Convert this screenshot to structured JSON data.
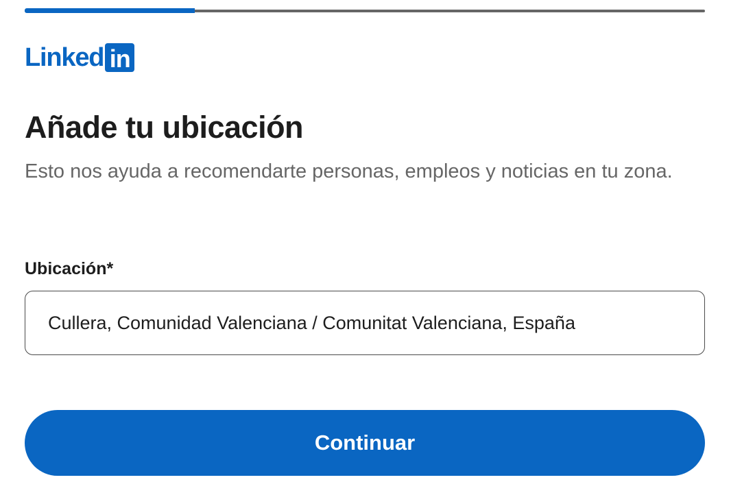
{
  "progress": {
    "value": 0.25
  },
  "logo": {
    "text": "Linked",
    "badge": "in"
  },
  "header": {
    "title": "Añade tu ubicación",
    "subtitle": "Esto nos ayuda a recomendarte personas, empleos y noticias en tu zona."
  },
  "form": {
    "location_label": "Ubicación*",
    "location_value": "Cullera, Comunidad Valenciana / Comunitat Valenciana, España"
  },
  "actions": {
    "continue_label": "Continuar"
  },
  "colors": {
    "brand": "#0a66c2",
    "text": "#1d1d1d",
    "muted": "#666666"
  }
}
